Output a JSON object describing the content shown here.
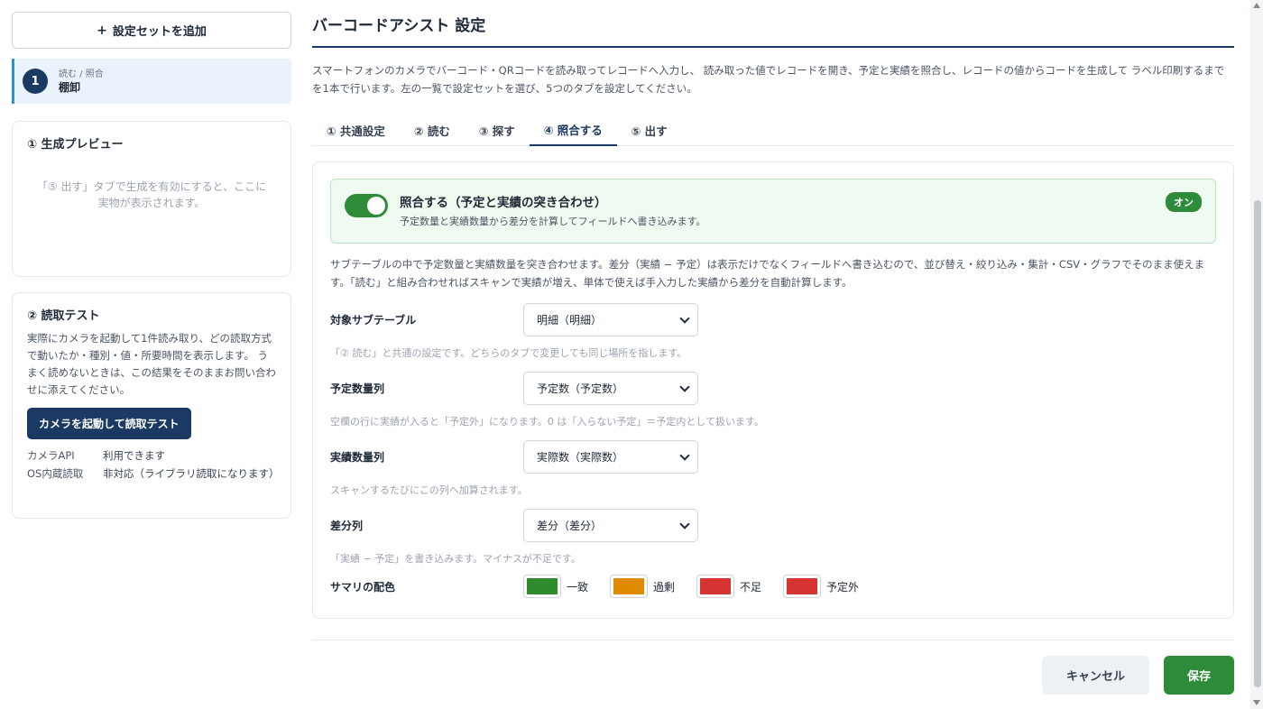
{
  "sidebar": {
    "add_set_label": "設定セットを追加",
    "set_item": {
      "number": "1",
      "subtitle": "読む / 照合",
      "name": "棚卸"
    },
    "preview": {
      "title": "① 生成プレビュー",
      "message_line1": "「⑤ 出す」タブで生成を有効にすると、ここに",
      "message_line2": "実物が表示されます。"
    },
    "read_test": {
      "title": "② 読取テスト",
      "description": "実際にカメラを起動して1件読み取り、どの読取方式で動いたか・種別・値・所要時間を表示します。 うまく読めないときは、この結果をそのままお問い合わせに添えてください。",
      "button_label": "カメラを起動して読取テスト",
      "rows": [
        {
          "key": "カメラAPI",
          "value": "利用できます"
        },
        {
          "key": "OS内蔵読取",
          "value": "非対応（ライブラリ読取になります）"
        }
      ]
    }
  },
  "main": {
    "title": "バーコードアシスト 設定",
    "intro": "スマートフォンのカメラでバーコード・QRコードを読み取ってレコードへ入力し、 読み取った値でレコードを開き、予定と実績を照合し、レコードの値からコードを生成して ラベル印刷するまでを1本で行います。左の一覧で設定セットを選び、5つのタブを設定してください。",
    "tabs": [
      {
        "label": "① 共通設定",
        "active": false
      },
      {
        "label": "② 読む",
        "active": false
      },
      {
        "label": "③ 探す",
        "active": false
      },
      {
        "label": "④ 照合する",
        "active": true
      },
      {
        "label": "⑤ 出す",
        "active": false
      }
    ],
    "toggle": {
      "title": "照合する（予定と実績の突き合わせ）",
      "description": "予定数量と実績数量から差分を計算してフィールドへ書き込みます。",
      "badge": "オン",
      "enabled": true
    },
    "description": "サブテーブルの中で予定数量と実績数量を突き合わせます。差分（実績 − 予定）は表示だけでなくフィールドへ書き込むので、並び替え・絞り込み・集計・CSV・グラフでそのまま使えます。「読む」と組み合わせればスキャンで実績が増え、単体で使えば手入力した実績から差分を自動計算します。",
    "fields": [
      {
        "label": "対象サブテーブル",
        "value": "明細（明細）",
        "hint": "「② 読む」と共通の設定です。どちらのタブで変更しても同じ場所を指します。"
      },
      {
        "label": "予定数量列",
        "value": "予定数（予定数）",
        "hint": "空欄の行に実績が入ると「予定外」になります。0 は「入らない予定」＝予定内として扱います。"
      },
      {
        "label": "実績数量列",
        "value": "実際数（実際数）",
        "hint": "スキャンするたびにこの列へ加算されます。"
      },
      {
        "label": "差分列",
        "value": "差分（差分）",
        "hint": "「実績 − 予定」を書き込みます。マイナスが不足です。"
      }
    ],
    "summary_colors": {
      "label": "サマリの配色",
      "items": [
        {
          "label": "一致",
          "color": "#2e8b2e"
        },
        {
          "label": "過剰",
          "color": "#e08a00"
        },
        {
          "label": "不足",
          "color": "#d63333"
        },
        {
          "label": "予定外",
          "color": "#d63333"
        }
      ]
    },
    "footer": {
      "cancel_label": "キャンセル",
      "save_label": "保存"
    }
  }
}
